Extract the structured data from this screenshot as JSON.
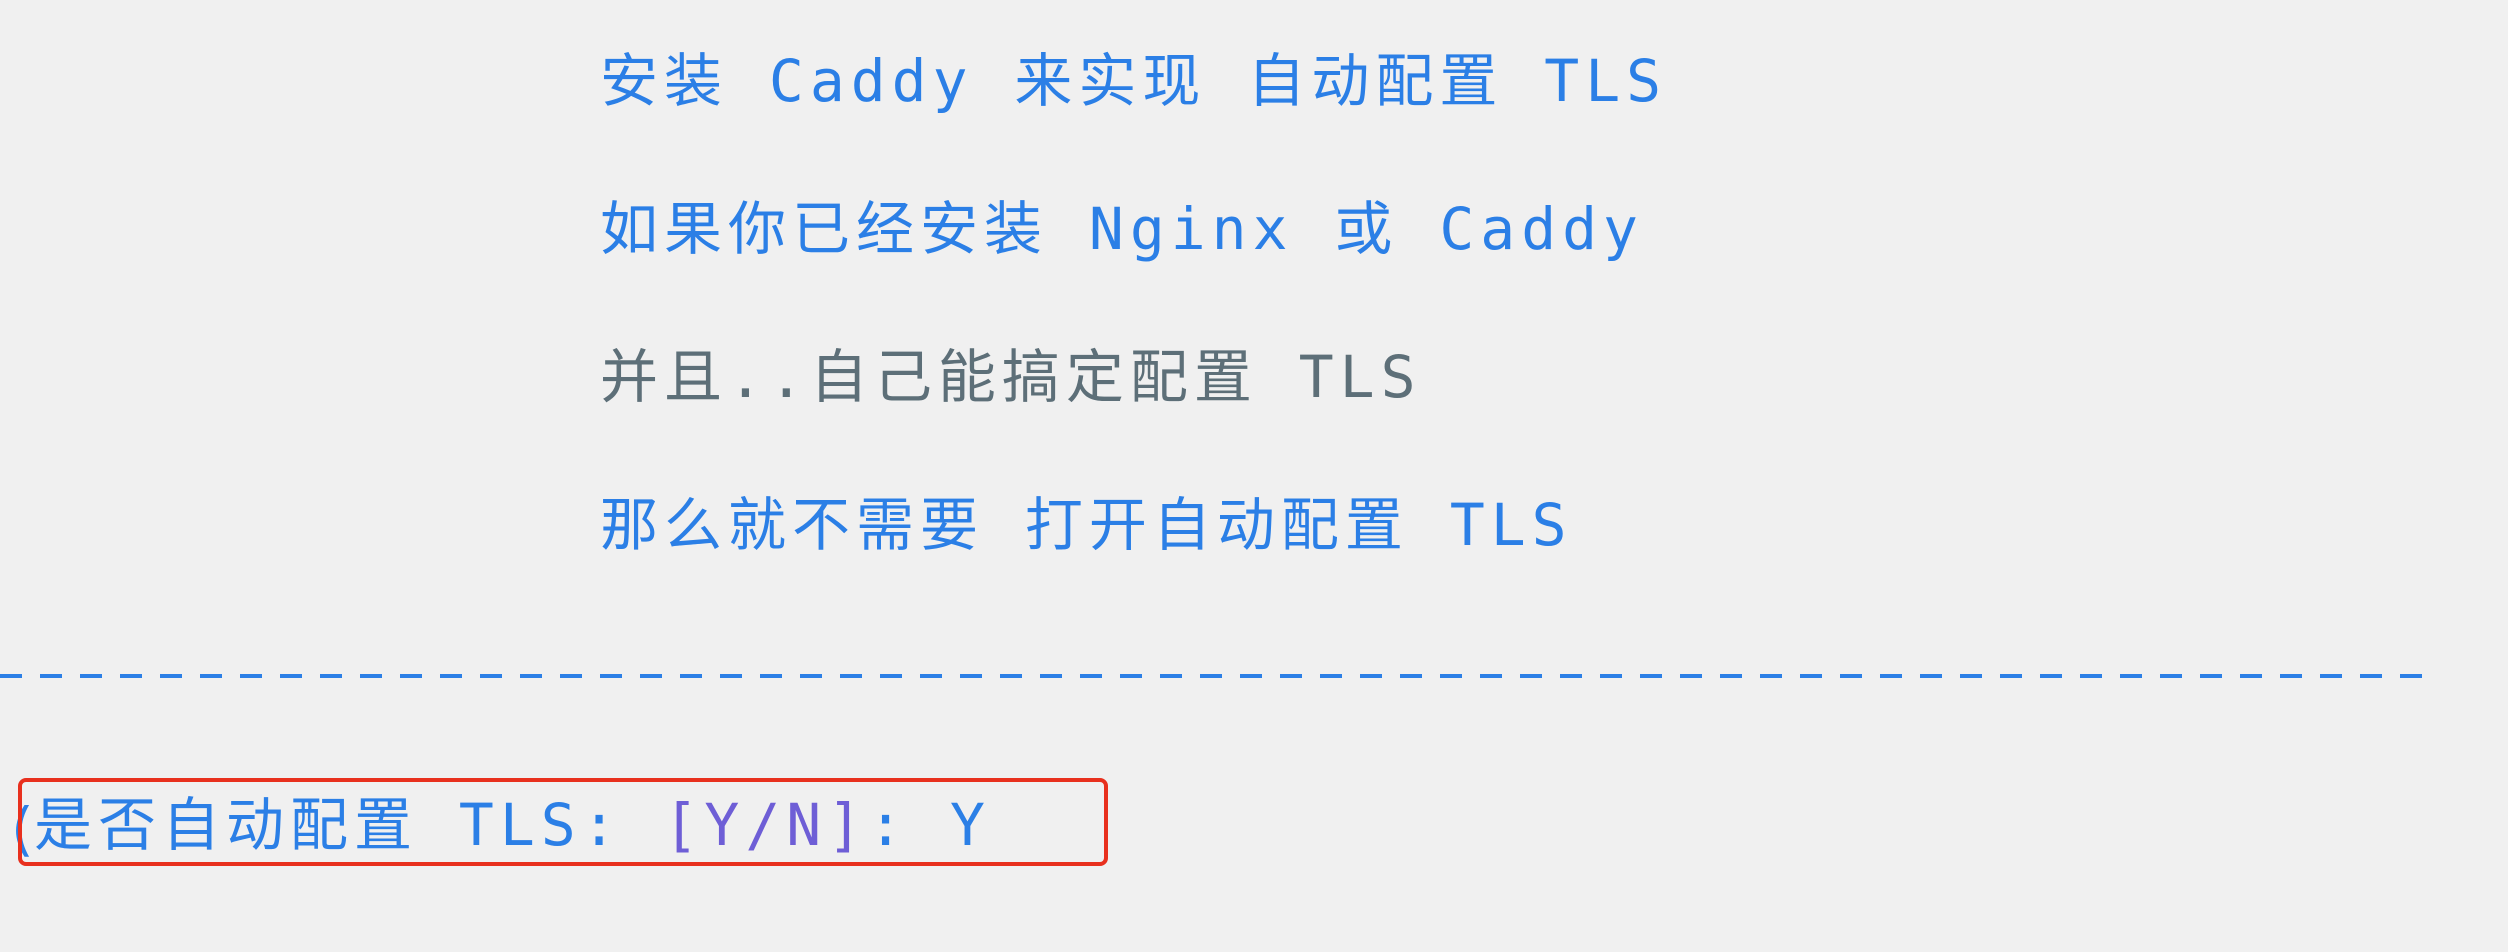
{
  "messages": [
    {
      "text": "安装 Caddy 来实现 自动配置 TLS",
      "color": "#2b7fe6"
    },
    {
      "text": "如果你已经安装 Nginx 或 Caddy",
      "color": "#2b7fe6"
    },
    {
      "text": "并且..自己能搞定配置 TLS",
      "color": "#5d6f78"
    },
    {
      "text": "那么就不需要 打开自动配置 TLS",
      "color": "#2b7fe6"
    }
  ],
  "separator": {
    "style": "dashed",
    "color": "#2b7fe6"
  },
  "prompt": {
    "question": "是否自动配置 TLS: ",
    "options": "[Y/N]",
    "suffix": ": ",
    "answer": "Y",
    "cursor_glyph": "(",
    "highlight_color": "#e8301e"
  }
}
